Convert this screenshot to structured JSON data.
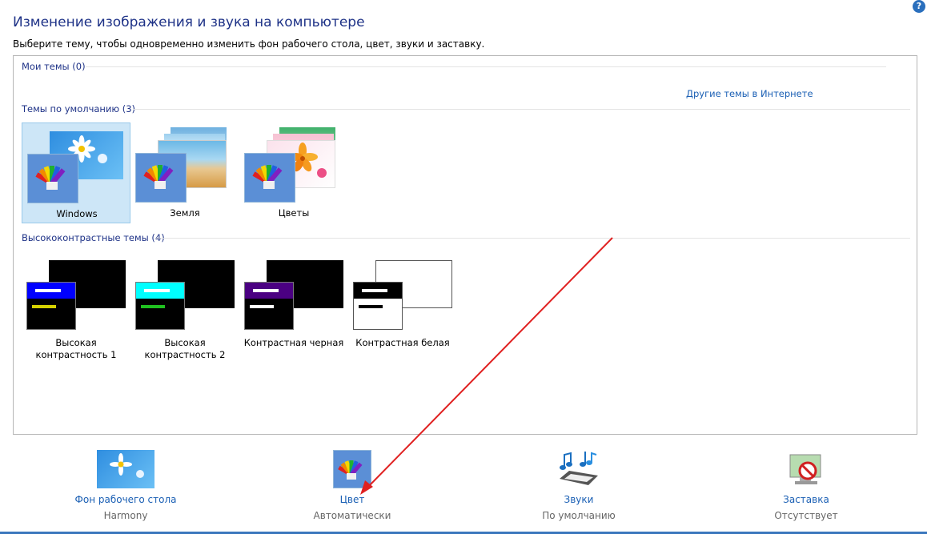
{
  "page": {
    "title": "Изменение изображения и звука на компьютере",
    "subtitle": "Выберите тему, чтобы одновременно изменить фон рабочего стола, цвет, звуки и заставку.",
    "help_icon": "help-icon"
  },
  "themes": {
    "my_themes_label": "Мои темы (0)",
    "online_link": "Другие темы в Интернете",
    "default_label": "Темы по умолчанию (3)",
    "default_items": [
      {
        "label": "Windows",
        "selected": true
      },
      {
        "label": "Земля",
        "selected": false
      },
      {
        "label": "Цветы",
        "selected": false
      }
    ],
    "hc_label": "Высококонтрастные темы (4)",
    "hc_items": [
      {
        "label": "Высокая контрастность 1",
        "header_color": "#0000ff",
        "bar1": "#ffffff",
        "bar2": "#d6d200"
      },
      {
        "label": "Высокая контрастность 2",
        "header_color": "#00ffff",
        "bar1": "#ffffff",
        "bar2": "#20c020"
      },
      {
        "label": "Контрастная черная",
        "header_color": "#4b0082",
        "bar1": "#ffffff",
        "bar2": "#ffffff"
      },
      {
        "label": "Контрастная белая",
        "header_color": "#000000",
        "bar1": "#ffffff",
        "bar2": "#000000"
      }
    ]
  },
  "bottom": {
    "background": {
      "link": "Фон рабочего стола",
      "value": "Harmony"
    },
    "color": {
      "link": "Цвет",
      "value": "Автоматически"
    },
    "sounds": {
      "link": "Звуки",
      "value": "По умолчанию"
    },
    "screensaver": {
      "link": "Заставка",
      "value": "Отсутствует"
    }
  },
  "colors": {
    "accent": "#1e3287",
    "link": "#1a5fb4",
    "selection": "#cde6f7",
    "arrow": "#e02020"
  }
}
